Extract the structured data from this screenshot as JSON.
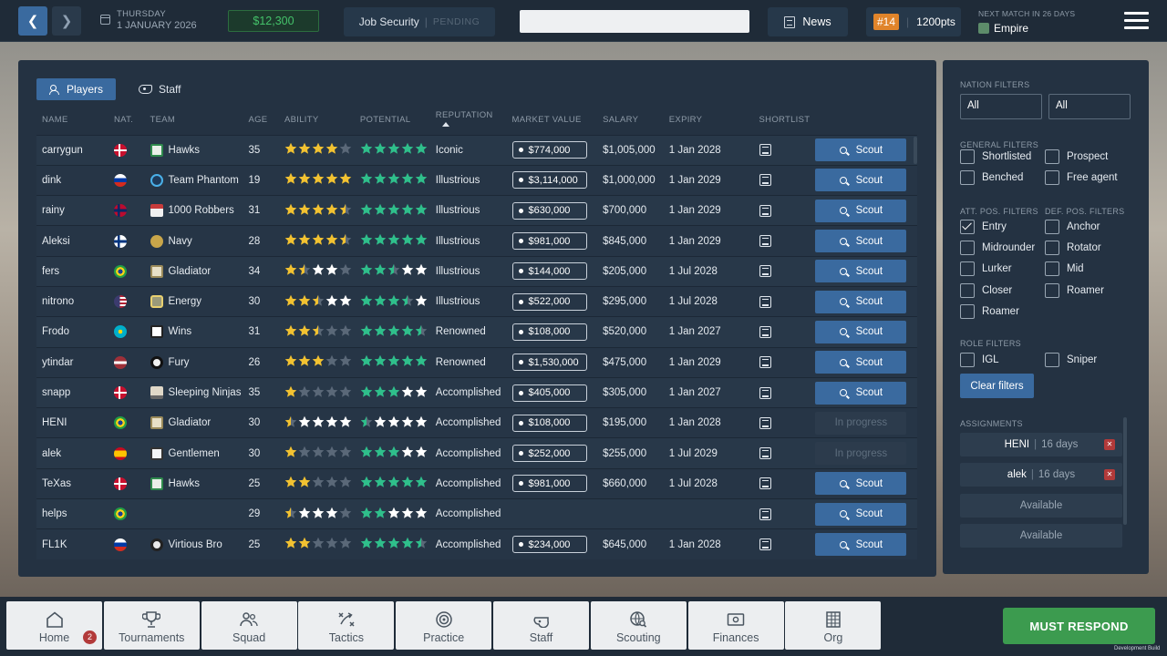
{
  "header": {
    "date_day": "THURSDAY",
    "date_full": "1 JANUARY 2026",
    "balance": "$12,300",
    "job_security_label": "Job Security",
    "job_security_status": "PENDING",
    "search_placeholder": "",
    "news_label": "News",
    "rank": "#14",
    "points": "1200pts",
    "next_match_label": "NEXT MATCH IN 26 DAYS",
    "next_match_team": "Empire"
  },
  "tabs": [
    {
      "label": "Players",
      "active": true
    },
    {
      "label": "Staff",
      "active": false
    }
  ],
  "columns": [
    "NAME",
    "NAT.",
    "TEAM",
    "AGE",
    "ABILITY",
    "POTENTIAL",
    "REPUTATION",
    "MARKET VALUE",
    "SALARY",
    "EXPIRY",
    "SHORTLIST"
  ],
  "players": [
    {
      "name": "carrygun",
      "nat": "DK",
      "team": "Hawks",
      "team_logo": "hawks",
      "age": "35",
      "ability": 4,
      "potential": 5,
      "reputation": "Iconic",
      "market_value": "$774,000",
      "salary": "$1,005,000",
      "expiry": "1 Jan 2028",
      "scout": "Scout",
      "in_progress": false
    },
    {
      "name": "dink",
      "nat": "RU",
      "team": "Team Phantom",
      "team_logo": "phantom",
      "age": "19",
      "ability": 5,
      "potential": 5,
      "reputation": "Illustrious",
      "market_value": "$3,114,000",
      "salary": "$1,000,000",
      "expiry": "1 Jan 2029",
      "scout": "Scout",
      "in_progress": false
    },
    {
      "name": "rainy",
      "nat": "NO",
      "team": "1000 Robbers",
      "team_logo": "robbers",
      "age": "31",
      "ability": 4.5,
      "potential": 5,
      "reputation": "Illustrious",
      "market_value": "$630,000",
      "salary": "$700,000",
      "expiry": "1 Jan 2029",
      "scout": "Scout",
      "in_progress": false
    },
    {
      "name": "Aleksi",
      "nat": "FI",
      "team": "Navy",
      "team_logo": "navy",
      "age": "28",
      "ability": 4.5,
      "potential": 5,
      "reputation": "Illustrious",
      "market_value": "$981,000",
      "salary": "$845,000",
      "expiry": "1 Jan 2029",
      "scout": "Scout",
      "in_progress": false
    },
    {
      "name": "fers",
      "nat": "BR",
      "team": "Gladiator",
      "team_logo": "gladiator",
      "age": "34",
      "ability": 1.5,
      "potential": 2.5,
      "potential_max": 5,
      "ability_max": 4,
      "reputation": "Illustrious",
      "market_value": "$144,000",
      "salary": "$205,000",
      "expiry": "1 Jul 2028",
      "scout": "Scout",
      "in_progress": false
    },
    {
      "name": "nitrono",
      "nat": "US",
      "team": "Energy",
      "team_logo": "energy",
      "age": "30",
      "ability": 2.5,
      "potential": 3.5,
      "ability_max": 4.5,
      "potential_max": 5,
      "reputation": "Illustrious",
      "market_value": "$522,000",
      "salary": "$295,000",
      "expiry": "1 Jul 2028",
      "scout": "Scout",
      "in_progress": false
    },
    {
      "name": "Frodo",
      "nat": "KZ",
      "team": "Wins",
      "team_logo": "wins",
      "age": "31",
      "ability": 2.5,
      "potential": 4.5,
      "reputation": "Renowned",
      "market_value": "$108,000",
      "salary": "$520,000",
      "expiry": "1 Jan 2027",
      "scout": "Scout",
      "in_progress": false
    },
    {
      "name": "ytindar",
      "nat": "LV",
      "team": "Fury",
      "team_logo": "fury",
      "age": "26",
      "ability": 3,
      "potential": 5,
      "reputation": "Renowned",
      "market_value": "$1,530,000",
      "salary": "$475,000",
      "expiry": "1 Jan 2029",
      "scout": "Scout",
      "in_progress": false
    },
    {
      "name": "snapp",
      "nat": "DK",
      "team": "Sleeping Ninjas",
      "team_logo": "ninjas",
      "age": "35",
      "ability": 1,
      "potential": 3,
      "potential_max": 5,
      "reputation": "Accomplished",
      "market_value": "$405,000",
      "salary": "$305,000",
      "expiry": "1 Jan 2027",
      "scout": "Scout",
      "in_progress": false
    },
    {
      "name": "HENI",
      "nat": "BR",
      "team": "Gladiator",
      "team_logo": "gladiator",
      "age": "30",
      "ability": 0.5,
      "ability_max": 5,
      "potential": 0.5,
      "potential_max": 5,
      "reputation": "Accomplished",
      "market_value": "$108,000",
      "salary": "$195,000",
      "expiry": "1 Jan 2028",
      "scout": "In progress",
      "in_progress": true
    },
    {
      "name": "alek",
      "nat": "ES",
      "team": "Gentlemen",
      "team_logo": "gentlemen",
      "age": "30",
      "ability": 1,
      "potential": 3,
      "potential_max": 5,
      "reputation": "Accomplished",
      "market_value": "$252,000",
      "salary": "$255,000",
      "expiry": "1 Jul 2029",
      "scout": "In progress",
      "in_progress": true
    },
    {
      "name": "TeXas",
      "nat": "DK",
      "team": "Hawks",
      "team_logo": "hawks",
      "age": "25",
      "ability": 2,
      "potential": 5,
      "reputation": "Accomplished",
      "market_value": "$981,000",
      "salary": "$660,000",
      "expiry": "1 Jul 2028",
      "scout": "Scout",
      "in_progress": false
    },
    {
      "name": "helps",
      "nat": "BR",
      "team": "",
      "team_logo": "",
      "age": "29",
      "ability": 0.5,
      "ability_max": 4,
      "potential": 2,
      "potential_max": 5,
      "reputation": "Accomplished",
      "market_value": "",
      "salary": "",
      "expiry": "",
      "scout": "Scout",
      "in_progress": false
    },
    {
      "name": "FL1K",
      "nat": "RU",
      "team": "Virtious Bro",
      "team_logo": "virtious",
      "age": "25",
      "ability": 2,
      "potential": 4.5,
      "reputation": "Accomplished",
      "market_value": "$234,000",
      "salary": "$645,000",
      "expiry": "1 Jan 2028",
      "scout": "Scout",
      "in_progress": false
    }
  ],
  "filters": {
    "nation_label": "NATION FILTERS",
    "nation_values": [
      "All",
      "All"
    ],
    "general_label": "GENERAL FILTERS",
    "general": [
      {
        "label": "Shortlisted",
        "checked": false
      },
      {
        "label": "Prospect",
        "checked": false
      },
      {
        "label": "Benched",
        "checked": false
      },
      {
        "label": "Free agent",
        "checked": false
      }
    ],
    "att_label": "ATT. POS. FILTERS",
    "att": [
      {
        "label": "Entry",
        "checked": true
      },
      {
        "label": "Midrounder",
        "checked": false
      },
      {
        "label": "Lurker",
        "checked": false
      },
      {
        "label": "Closer",
        "checked": false
      },
      {
        "label": "Roamer",
        "checked": false
      }
    ],
    "def_label": "DEF. POS. FILTERS",
    "def": [
      {
        "label": "Anchor",
        "checked": false
      },
      {
        "label": "Rotator",
        "checked": false
      },
      {
        "label": "Mid",
        "checked": false
      },
      {
        "label": "Roamer",
        "checked": false
      }
    ],
    "role_label": "ROLE FILTERS",
    "role": [
      {
        "label": "IGL",
        "checked": false
      },
      {
        "label": "Sniper",
        "checked": false
      }
    ],
    "clear_label": "Clear filters",
    "assignments_label": "ASSIGNMENTS",
    "assignments": [
      {
        "name": "HENI",
        "days": "16 days"
      },
      {
        "name": "alek",
        "days": "16 days"
      }
    ],
    "available_label": "Available"
  },
  "bottom_nav": [
    {
      "label": "Home",
      "icon": "home-icon",
      "badge": "2"
    },
    {
      "label": "Tournaments",
      "icon": "trophy-icon"
    },
    {
      "label": "Squad",
      "icon": "squad-icon"
    },
    {
      "label": "Tactics",
      "icon": "tactics-icon"
    },
    {
      "label": "Practice",
      "icon": "target-icon"
    },
    {
      "label": "Staff",
      "icon": "whistle-icon"
    },
    {
      "label": "Scouting",
      "icon": "scouting-globe-icon"
    },
    {
      "label": "Finances",
      "icon": "money-icon"
    },
    {
      "label": "Org",
      "icon": "building-icon"
    }
  ],
  "must_respond": "MUST RESPOND",
  "dev_build": "Development Build",
  "colors": {
    "accent": "#3a6a9f",
    "star_gold": "#f2c231",
    "star_green": "#2fbf8b",
    "star_empty": "#5a6878",
    "success": "#3c9b4f",
    "danger": "#b23a3a"
  }
}
